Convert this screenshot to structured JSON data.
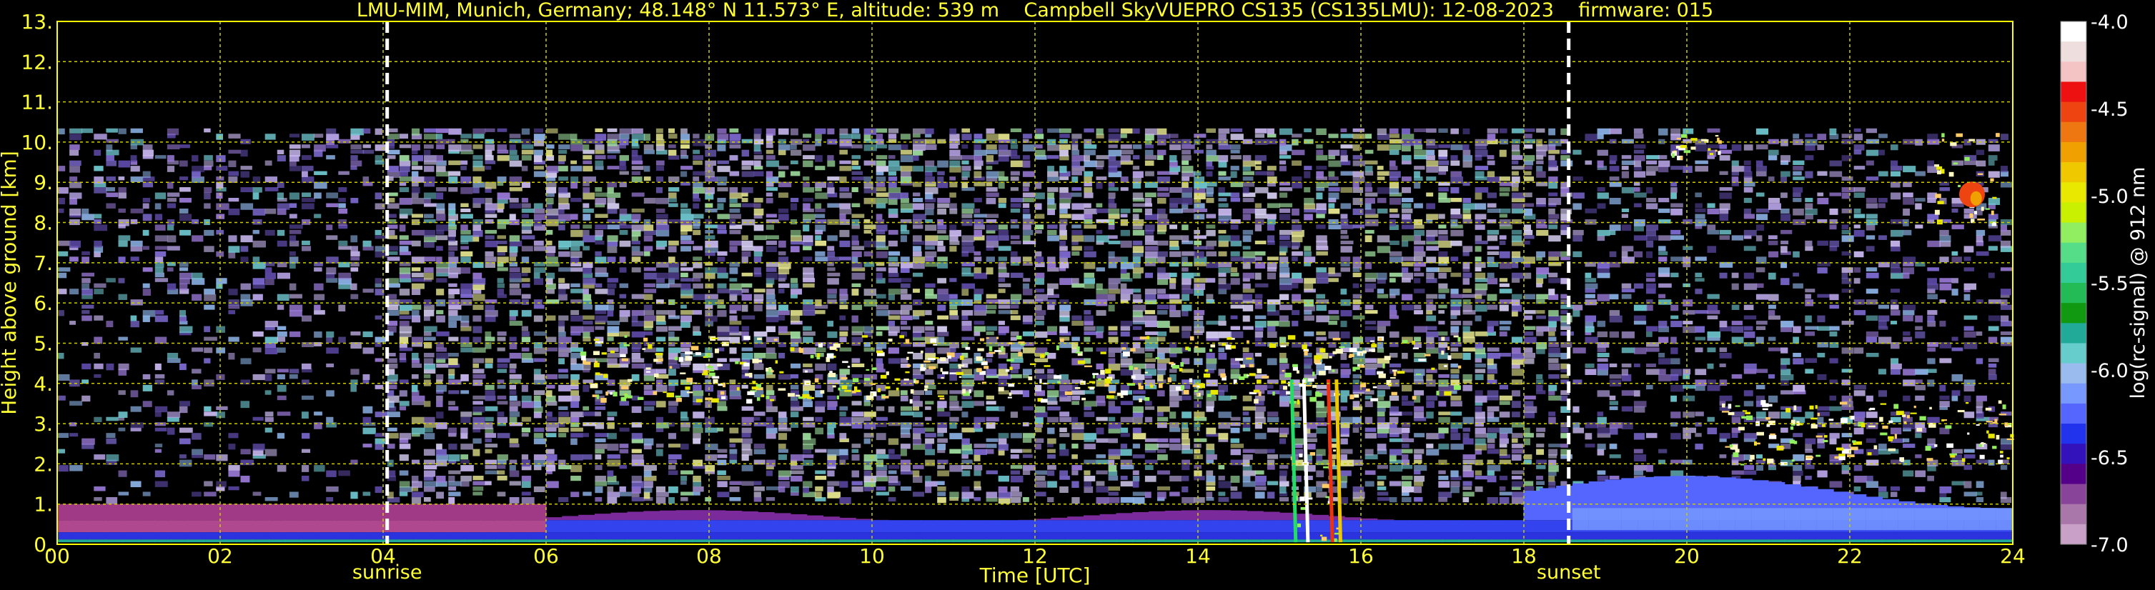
{
  "chart_data": {
    "type": "heatmap",
    "title": "LMU-MIM, Munich, Germany; 48.148° N 11.573° E, altitude: 539 m    Campbell SkyVUEPRO CS135 (CS135LMU): 12-08-2023    firmware: 015",
    "xlabel": "Time [UTC]",
    "ylabel": "Height above ground [km]",
    "xlim": [
      0,
      24
    ],
    "ylim": [
      0,
      13
    ],
    "x_ticks": [
      "00",
      "02",
      "04",
      "06",
      "08",
      "10",
      "12",
      "14",
      "16",
      "18",
      "20",
      "22",
      "24"
    ],
    "y_ticks": [
      "0.",
      "1.",
      "2.",
      "3.",
      "4.",
      "5.",
      "6.",
      "7.",
      "8.",
      "9.",
      "10.",
      "11.",
      "12.",
      "13."
    ],
    "grid": true,
    "events": [
      {
        "label": "sunrise",
        "time": 4.05
      },
      {
        "label": "sunset",
        "time": 18.55
      }
    ],
    "colorbar": {
      "label": "log(rc-signal) @ 912 nm",
      "range": [
        -7.0,
        -4.0
      ],
      "ticks": [
        "-4.0",
        "-4.5",
        "-5.0",
        "-5.5",
        "-6.0",
        "-6.5",
        "-7.0"
      ],
      "colors": [
        "#ffffff",
        "#efdede",
        "#f4c4c4",
        "#ee1111",
        "#ee4411",
        "#ee7711",
        "#f0a000",
        "#f0c800",
        "#e8e800",
        "#c8f000",
        "#90ee60",
        "#55dd88",
        "#33cc99",
        "#22bb55",
        "#119911",
        "#22aa99",
        "#66cccc",
        "#99bbee",
        "#7799ff",
        "#5566ff",
        "#2233ee",
        "#3311bb",
        "#550088",
        "#884499",
        "#aa77aa",
        "#c8a0c8"
      ]
    },
    "features": [
      {
        "name": "boundary layer",
        "start": 0,
        "end": 24,
        "base_km": 0.1,
        "top_km": 1.0
      },
      {
        "name": "noise region",
        "start": 0,
        "end": 24,
        "base_km": 1.0,
        "top_km": 10.3
      },
      {
        "name": "mid-level cloud",
        "start": 6.4,
        "end": 17.2,
        "base_km": 3.6,
        "top_km": 5.2
      },
      {
        "name": "precipitation streak",
        "start": 15.1,
        "end": 15.7,
        "base_km": 0.0,
        "top_km": 4.2
      },
      {
        "name": "high cloud",
        "start": 23.0,
        "end": 23.8,
        "base_km": 8.0,
        "top_km": 10.3
      },
      {
        "name": "high cloud",
        "start": 19.8,
        "end": 20.4,
        "base_km": 9.6,
        "top_km": 10.2
      },
      {
        "name": "evening cloud",
        "start": 20.4,
        "end": 24.0,
        "base_km": 2.0,
        "top_km": 3.6
      }
    ]
  }
}
